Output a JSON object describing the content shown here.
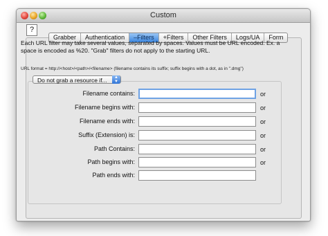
{
  "window": {
    "title": "Custom"
  },
  "help_label": "?",
  "tabs": [
    {
      "label": "Grabber",
      "active": false
    },
    {
      "label": "Authentication",
      "active": false
    },
    {
      "label": "–Filters",
      "active": true
    },
    {
      "label": "+Filters",
      "active": false
    },
    {
      "label": "Other Filters",
      "active": false
    },
    {
      "label": "Logs/UA",
      "active": false
    },
    {
      "label": "Form",
      "active": false
    }
  ],
  "description": "Each URL filter may take several values, separated by spaces. Values must be URL encoded. Ex. a space is encoded as %20. \"Grab\" filters do not apply to the starting URL.",
  "url_format": "URL format = http://<host>/<path>/<filename>  (filename contains its suffix; suffix begins with a dot, as in \".dmg\")",
  "popup": {
    "selected": "Do not grab a resource if..."
  },
  "filters": [
    {
      "label": "Filename contains:",
      "value": "",
      "or": "or"
    },
    {
      "label": "Filename begins with:",
      "value": "",
      "or": "or"
    },
    {
      "label": "Filename ends with:",
      "value": "",
      "or": "or"
    },
    {
      "label": "Suffix (Extension) is:",
      "value": "",
      "or": "or"
    },
    {
      "label": "Path Contains:",
      "value": "",
      "or": "or"
    },
    {
      "label": "Path begins with:",
      "value": "",
      "or": "or"
    },
    {
      "label": "Path ends with:",
      "value": "",
      "or": ""
    }
  ]
}
